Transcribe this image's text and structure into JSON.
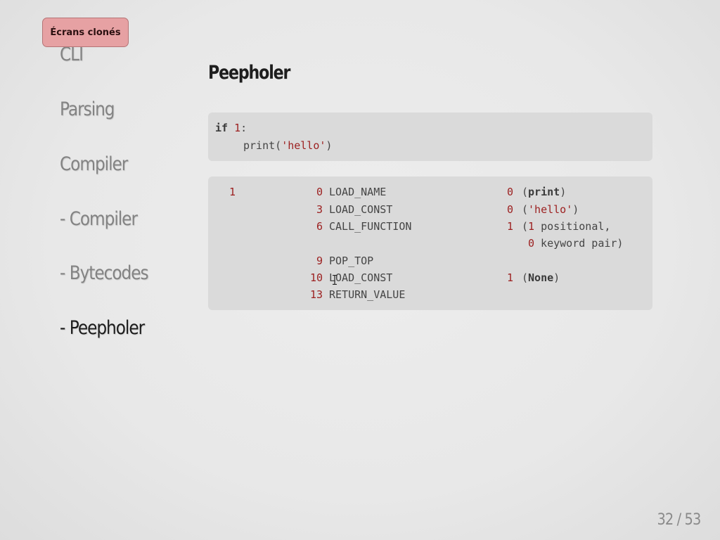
{
  "badge": {
    "label": "Écrans clonés"
  },
  "nav": {
    "items": [
      {
        "label": "CLI"
      },
      {
        "label": "Parsing"
      },
      {
        "label": "Compiler"
      },
      {
        "label": "- Compiler"
      },
      {
        "label": "- Bytecodes"
      },
      {
        "label": "- Peepholer"
      }
    ],
    "active_item": "- Peepholer"
  },
  "slide": {
    "title": "Peepholer"
  },
  "source_code": {
    "line1": {
      "keyword": "if",
      "number": "1",
      "colon": ":"
    },
    "line2": {
      "func": "print(",
      "string": "'hello'",
      "close": ")"
    }
  },
  "disassembly": {
    "source_line": "1",
    "rows": [
      {
        "offset": "0",
        "opname": "LOAD_NAME",
        "arg": "0",
        "argrepr_open": "(",
        "argrepr": "print",
        "argrepr_close": ")"
      },
      {
        "offset": "3",
        "opname": "LOAD_CONST",
        "arg": "0",
        "argrepr_open": "(",
        "argrepr": "'hello'",
        "argrepr_close": ")"
      },
      {
        "offset": "6",
        "opname": "CALL_FUNCTION",
        "arg": "1",
        "argrepr_open": "(",
        "argrepr_num": "1",
        "argrepr": " positional,",
        "argrepr_cont_num": "0",
        "argrepr_cont": " keyword pair)"
      },
      {
        "offset": "9",
        "opname": "POP_TOP"
      },
      {
        "offset": "10",
        "opname": "LOAD_CONST",
        "arg": "1",
        "argrepr_open": "(",
        "argrepr": "None",
        "argrepr_close": ")"
      },
      {
        "offset": "13",
        "opname": "RETURN_VALUE"
      }
    ]
  },
  "pager": {
    "text": "32 / 53"
  },
  "colors": {
    "background": "#e9e9e9",
    "badge": "#e6a1a3",
    "code_bg": "#dadada",
    "number_accent": "#9c1f1f",
    "nav_inactive": "#838383",
    "nav_active": "#1c1c1c"
  }
}
